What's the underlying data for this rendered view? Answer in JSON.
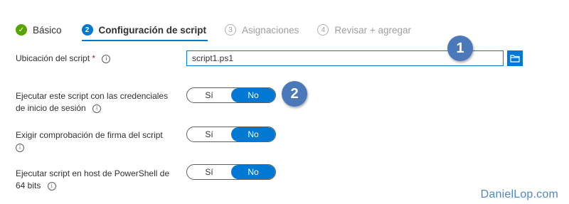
{
  "wizard": {
    "steps": [
      {
        "number": "✓",
        "label": "Básico",
        "state": "done"
      },
      {
        "number": "2",
        "label": "Configuración de script",
        "state": "active"
      },
      {
        "number": "3",
        "label": "Asignaciones",
        "state": "todo"
      },
      {
        "number": "4",
        "label": "Revisar + agregar",
        "state": "todo"
      }
    ]
  },
  "form": {
    "script_location": {
      "label": "Ubicación del script",
      "required_marker": "*",
      "info_icon": "i",
      "value": "script1.ps1",
      "browse_icon": "folder-icon"
    },
    "run_as_signed_in": {
      "label_line1": "Ejecutar este script con las credenciales",
      "label_line2": "de inicio de sesión",
      "info_icon": "i",
      "options": [
        "Sí",
        "No"
      ],
      "selected": "No"
    },
    "enforce_signature": {
      "label_line1": "Exigir comprobación de firma del script",
      "info_icon": "i",
      "options": [
        "Sí",
        "No"
      ],
      "selected": "No"
    },
    "run_64bit": {
      "label_line1": "Ejecutar script en host de PowerShell de",
      "label_line2": "64 bits",
      "info_icon": "i",
      "options": [
        "Sí",
        "No"
      ],
      "selected": "No"
    }
  },
  "callouts": [
    "1",
    "2"
  ],
  "watermark": "DanielLop.com",
  "colors": {
    "accent": "#0078d4",
    "done_green": "#57a300",
    "callout_blue": "#4b78b8",
    "required_red": "#a4262c",
    "watermark_blue": "#4f87c6"
  }
}
